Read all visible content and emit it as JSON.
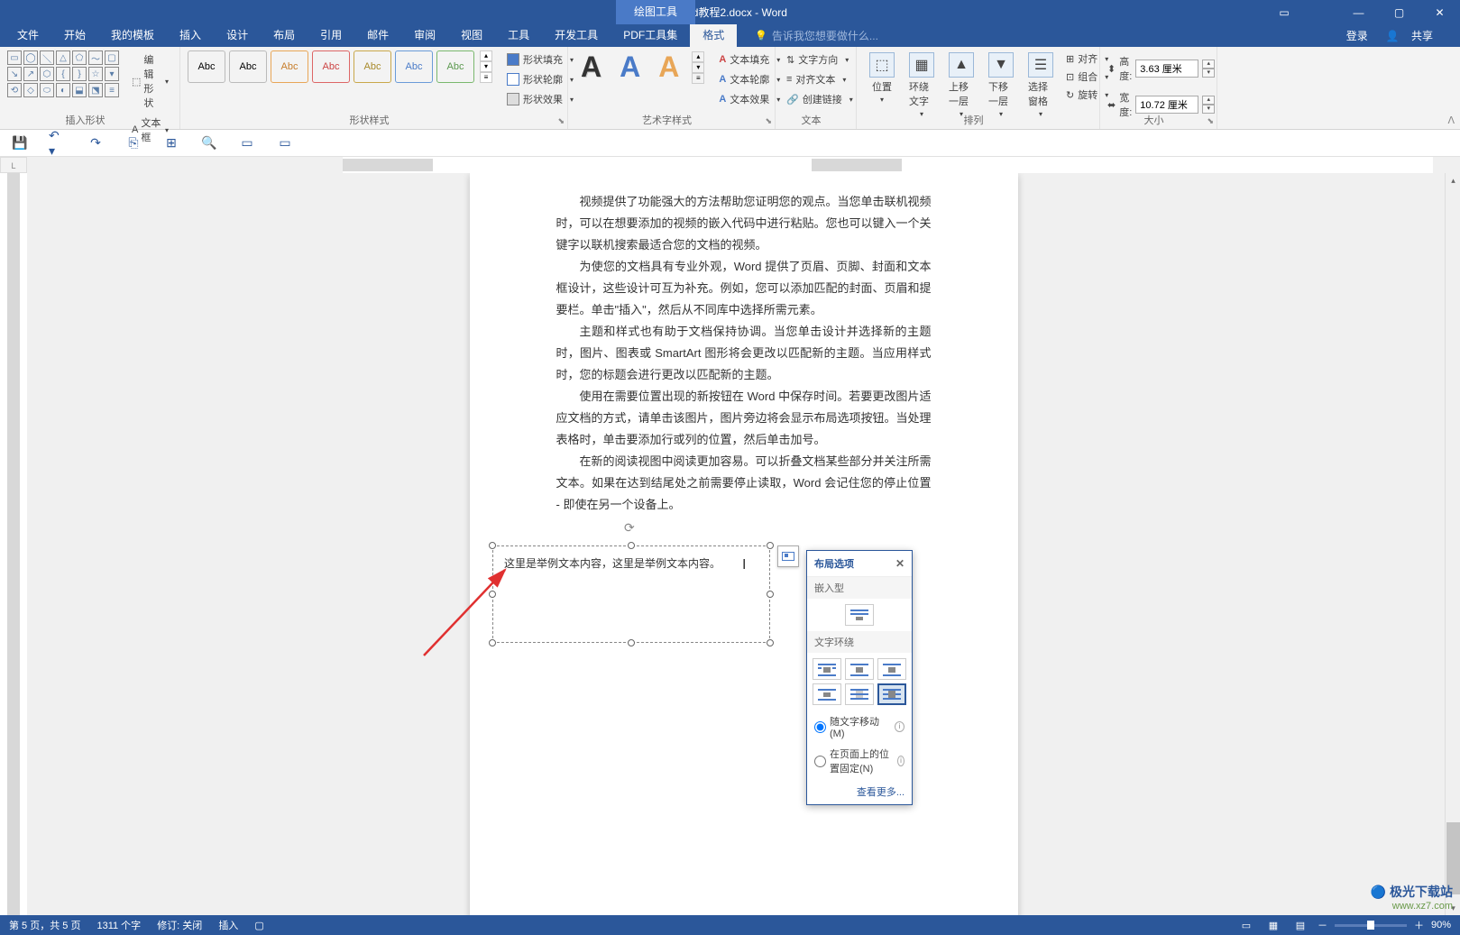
{
  "titlebar": {
    "title": "Word教程2.docx - Word",
    "context_tab": "绘图工具"
  },
  "tabs": {
    "file": "文件",
    "home": "开始",
    "templates": "我的模板",
    "insert": "插入",
    "design": "设计",
    "layout": "布局",
    "references": "引用",
    "mail": "邮件",
    "review": "审阅",
    "view": "视图",
    "tools": "工具",
    "dev": "开发工具",
    "pdf": "PDF工具集",
    "format": "格式",
    "tellme": "告诉我您想要做什么...",
    "login": "登录",
    "share": "共享"
  },
  "ribbon": {
    "insert_shape": {
      "label": "插入形状",
      "edit_shape": "编辑形状",
      "textbox": "文本框"
    },
    "shape_styles": {
      "label": "形状样式",
      "abc": "Abc",
      "fill": "形状填充",
      "outline": "形状轮廓",
      "effects": "形状效果"
    },
    "wordart": {
      "label": "艺术字样式",
      "text_fill": "文本填充",
      "text_outline": "文本轮廓",
      "text_effects": "文本效果"
    },
    "text": {
      "label": "文本",
      "direction": "文字方向",
      "align": "对齐文本",
      "link": "创建链接"
    },
    "arrange": {
      "label": "排列",
      "position": "位置",
      "wrap": "环绕文字",
      "forward": "上移一层",
      "backward": "下移一层",
      "pane": "选择窗格",
      "align_obj": "对齐",
      "group": "组合",
      "rotate": "旋转"
    },
    "size": {
      "label": "大小",
      "height_label": "高度:",
      "width_label": "宽度:",
      "height": "3.63 厘米",
      "width": "10.72 厘米"
    }
  },
  "document": {
    "p1": "视频提供了功能强大的方法帮助您证明您的观点。当您单击联机视频时，可以在想要添加的视频的嵌入代码中进行粘贴。您也可以键入一个关键字以联机搜索最适合您的文档的视频。",
    "p2": "为使您的文档具有专业外观，Word 提供了页眉、页脚、封面和文本框设计，这些设计可互为补充。例如，您可以添加匹配的封面、页眉和提要栏。单击\"插入\"，然后从不同库中选择所需元素。",
    "p3": "主题和样式也有助于文档保持协调。当您单击设计并选择新的主题时，图片、图表或 SmartArt 图形将会更改以匹配新的主题。当应用样式时，您的标题会进行更改以匹配新的主题。",
    "p4": "使用在需要位置出现的新按钮在 Word 中保存时间。若要更改图片适应文档的方式，请单击该图片，图片旁边将会显示布局选项按钮。当处理表格时，单击要添加行或列的位置，然后单击加号。",
    "p5": "在新的阅读视图中阅读更加容易。可以折叠文档某些部分并关注所需文本。如果在达到结尾处之前需要停止读取，Word 会记住您的停止位置 - 即使在另一个设备上。"
  },
  "textbox": {
    "content": "这里是举例文本内容，这里是举例文本内容。"
  },
  "layout_options": {
    "title": "布局选项",
    "inline": "嵌入型",
    "wrap": "文字环绕",
    "move_with_text": "随文字移动(M)",
    "fix_position": "在页面上的位置固定(N)",
    "see_more": "查看更多..."
  },
  "statusbar": {
    "page": "第 5 页，共 5 页",
    "words": "1311 个字",
    "track": "修订: 关闭",
    "insert": "插入",
    "zoom": "90%"
  },
  "watermark": {
    "brand": "极光下载站",
    "url": "www.xz7.com"
  }
}
